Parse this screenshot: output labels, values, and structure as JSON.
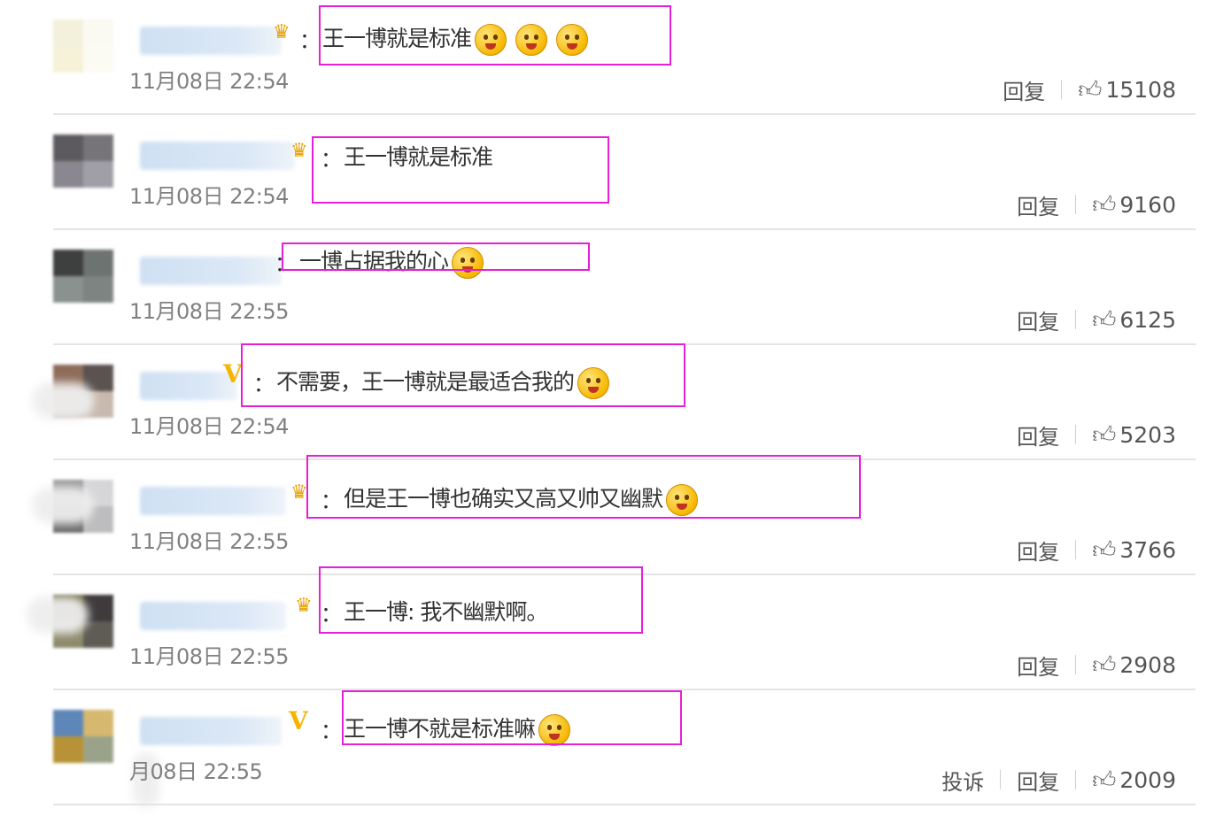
{
  "comments": [
    {
      "badge": "crown",
      "text": "王一博就是标准",
      "emojis": [
        "scared-emoji",
        "scared-emoji",
        "scared-emoji"
      ],
      "time": "11月08日 22:54",
      "actions": [
        "回复"
      ],
      "likes": "15108"
    },
    {
      "badge": "crown",
      "text": "王一博就是标准",
      "emojis": [],
      "time": "11月08日 22:54",
      "actions": [
        "回复"
      ],
      "likes": "9160"
    },
    {
      "badge": "none",
      "text": "一博占据我的心",
      "emojis": [
        "cat-emoji"
      ],
      "time": "11月08日 22:55",
      "actions": [
        "回复"
      ],
      "likes": "6125"
    },
    {
      "badge": "v",
      "text": "不需要，王一博就是最适合我的",
      "emojis": [
        "cat-emoji"
      ],
      "time": "11月08日 22:54",
      "actions": [
        "回复"
      ],
      "likes": "5203"
    },
    {
      "badge": "crown",
      "text": "但是王一博也确实又高又帅又幽默",
      "emojis": [
        "laughing-emoji"
      ],
      "time": "11月08日 22:55",
      "actions": [
        "回复"
      ],
      "likes": "3766"
    },
    {
      "badge": "crown",
      "text": "王一博: 我不幽默啊。",
      "emojis": [],
      "time": "11月08日 22:55",
      "actions": [
        "回复"
      ],
      "likes": "2908"
    },
    {
      "badge": "v",
      "text": "王一博不就是标准嘛",
      "emojis": [
        "screaming-emoji"
      ],
      "time": "月08日 22:55",
      "actions": [
        "投诉",
        "回复"
      ],
      "likes": "2009"
    }
  ],
  "colon": "：",
  "colors": {
    "highlight": "#e61fd8",
    "divider": "#e4e4e4",
    "timestamp": "#808080",
    "badge": "#f7b500"
  },
  "icons": {
    "like": "thumbs-up-icon",
    "crown": "crown-badge-icon",
    "verified": "v-badge-icon"
  }
}
